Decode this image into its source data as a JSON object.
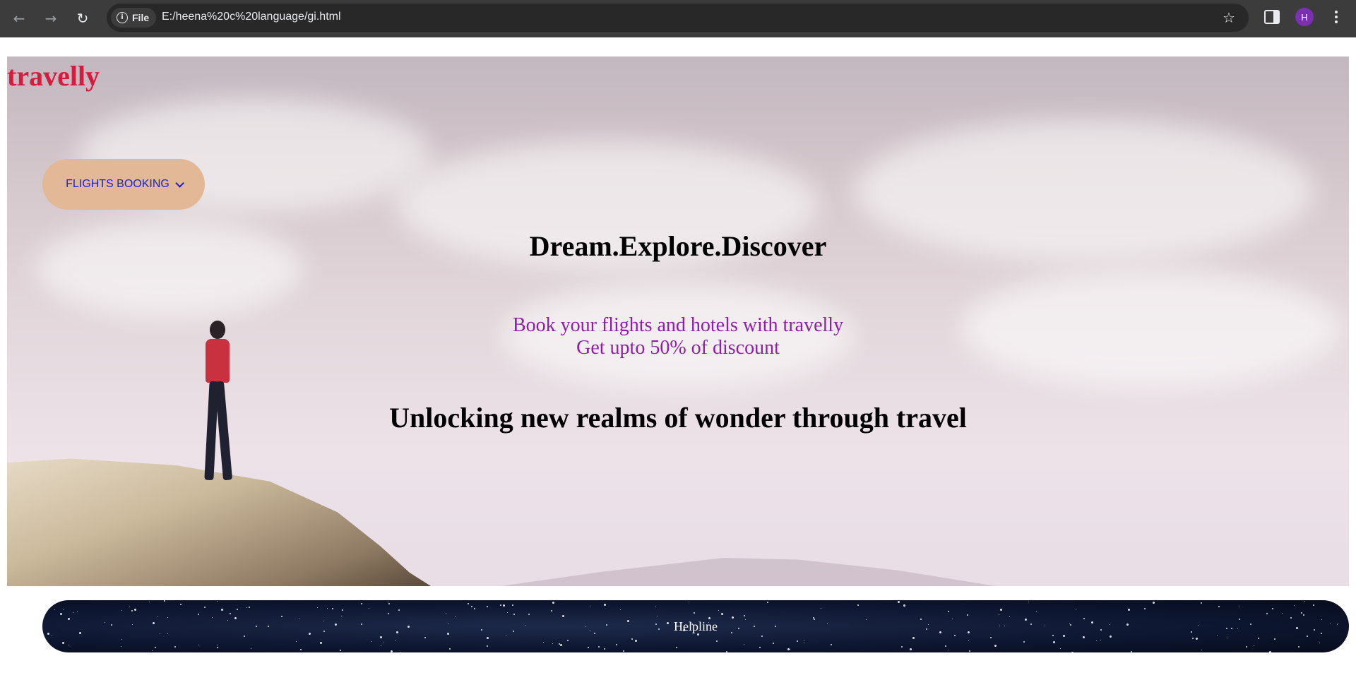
{
  "browser": {
    "back_icon": "arrow-left-icon",
    "forward_icon": "arrow-right-icon",
    "reload_icon": "reload-icon",
    "scheme_chip": "File",
    "url": "E:/heena%20c%20language/gi.html",
    "profile_initial": "H",
    "profile_color": "#7b2fb5"
  },
  "page": {
    "brand": "travelly",
    "brand_color": "#d81b3c",
    "flights_button": "FLIGHTS BOOKING",
    "flights_button_color": "#e2b896",
    "headline": "Dream.Explore.Discover",
    "sub_line_1": "Book your flights and hotels with travelly",
    "sub_line_2": "Get upto 50% of discount",
    "sub_color": "#8e1fa6",
    "tagline": "Unlocking new realms of wonder through travel",
    "helpline": "Helpline"
  }
}
